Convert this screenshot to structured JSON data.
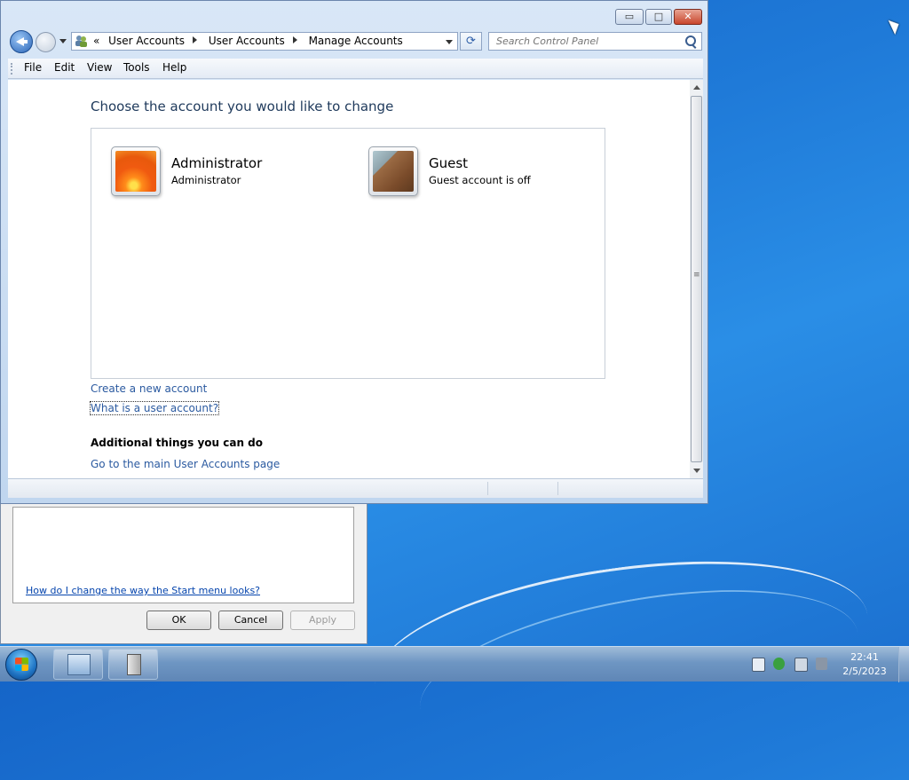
{
  "window": {
    "controls": {
      "minimize": "▭",
      "maximize": "□",
      "close": "✕"
    },
    "address": {
      "prefix": "«",
      "crumbs": [
        "User Accounts",
        "User Accounts",
        "Manage Accounts"
      ]
    },
    "search_placeholder": "Search Control Panel",
    "menu": [
      "File",
      "Edit",
      "View",
      "Tools",
      "Help"
    ]
  },
  "content": {
    "heading": "Choose the account you would like to change",
    "accounts": [
      {
        "name": "Administrator",
        "status": "Administrator",
        "icon": "flower-avatar-icon"
      },
      {
        "name": "Guest",
        "status": "Guest account is off",
        "icon": "briefcase-avatar-icon"
      }
    ],
    "links": {
      "create": "Create a new account",
      "what_is": "What is a user account?"
    },
    "additional_heading": "Additional things you can do",
    "main_page_link": "Go to the main User Accounts page"
  },
  "background_dialog": {
    "help_link": "How do I change the way the Start menu looks?",
    "buttons": {
      "ok": "OK",
      "cancel": "Cancel",
      "apply": "Apply"
    }
  },
  "taskbar": {
    "clock": {
      "time": "22:41",
      "date": "2/5/2023"
    }
  },
  "colors": {
    "accent": "#1e395b",
    "link": "#2b5aa0",
    "desktop": "#1f7ad8"
  }
}
